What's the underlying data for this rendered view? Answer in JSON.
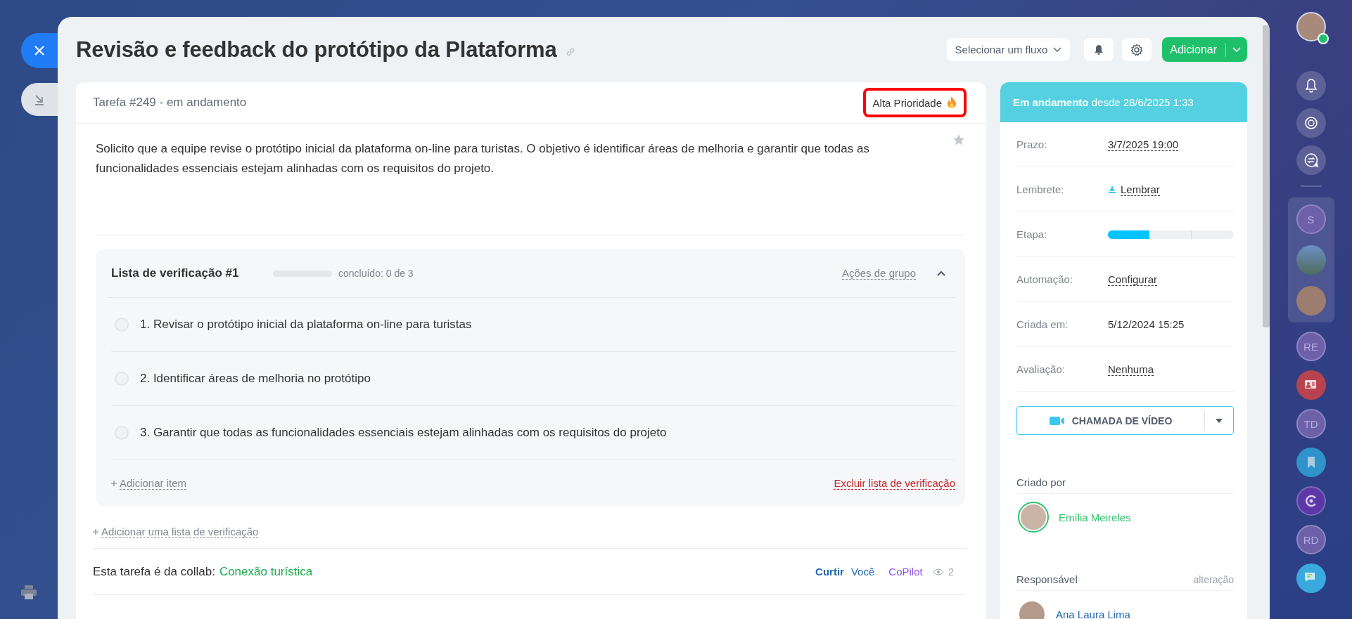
{
  "title": "Revisão e feedback do protótipo da Plataforma",
  "header": {
    "flow_select": "Selecionar um fluxo",
    "add_button": "Adicionar"
  },
  "task": {
    "status": "Tarefa #249 - em andamento",
    "priority": {
      "label": "Alta Prioridade",
      "highlighted": true
    },
    "starred": false,
    "description": "Solicito que a equipe revise o protótipo inicial da plataforma on-line para turistas. O objetivo é identificar áreas de melhoria e garantir que todas as funcionalidades essenciais estejam alinhadas com os requisitos do projeto.",
    "checklist": {
      "title": "Lista de verificação #1",
      "level": 0,
      "progress": "concluído: 0 de 3",
      "group_actions": "Ações de grupo",
      "expanded": true,
      "items": [
        {
          "text": "1. Revisar o protótipo inicial da plataforma on-line para turistas",
          "checked": false
        },
        {
          "text": "2. Identificar áreas de melhoria no protótipo",
          "checked": false
        },
        {
          "text": "3. Garantir que todas as funcionalidades essenciais estejam alinhadas com os requisitos do projeto",
          "checked": false
        }
      ],
      "add_item": "Adicionar item",
      "delete": "Excluir lista de verificação"
    },
    "add_checklist": "Adicionar uma lista de verificação",
    "collab": {
      "label": "Esta tarefa é da collab:",
      "link": "Conexão turística"
    },
    "reactions": {
      "like": "Curtir",
      "you": "Você",
      "copilot": "CoPilot",
      "views": "2"
    }
  },
  "sidebar": {
    "status": "**Em andamento** desde 28/6/2025 1:33",
    "fields": [
      {
        "kind": "link",
        "label": "Prazo:",
        "value": "3/7/2025 19:00"
      },
      {
        "kind": "reminder",
        "label": "Lembrete:",
        "value": "Lembrar"
      },
      {
        "kind": "progress",
        "label": "Etapa:",
        "level": 0.33
      },
      {
        "kind": "link",
        "label": "Automação:",
        "value": "Configurar"
      },
      {
        "kind": "text",
        "label": "Criada em:",
        "value": "5/12/2024 15:25"
      },
      {
        "kind": "link",
        "label": "Avaliação:",
        "value": "Nenhuma"
      }
    ],
    "video_button": "CHAMADA DE VÍDEO",
    "created_by": {
      "heading": "Criado por",
      "name": "Emília Meireles"
    },
    "responsible": {
      "heading": "Responsável",
      "action": "alteração",
      "name": "Ana Laura Lima"
    }
  },
  "right_rail": {
    "top": [
      {
        "kind": "user"
      },
      {
        "kind": "bell"
      },
      {
        "kind": "copilot"
      },
      {
        "kind": "chat-sync"
      }
    ],
    "pinned": [
      {
        "kind": "initials",
        "label": "S"
      },
      {
        "kind": "landscape"
      },
      {
        "kind": "person"
      }
    ],
    "items": [
      {
        "kind": "initials",
        "label": "RE"
      },
      {
        "kind": "contact"
      },
      {
        "kind": "initials",
        "label": "TD"
      },
      {
        "kind": "bookmark"
      },
      {
        "kind": "copilot-app"
      },
      {
        "kind": "initials",
        "label": "RD"
      },
      {
        "kind": "chat"
      }
    ]
  }
}
